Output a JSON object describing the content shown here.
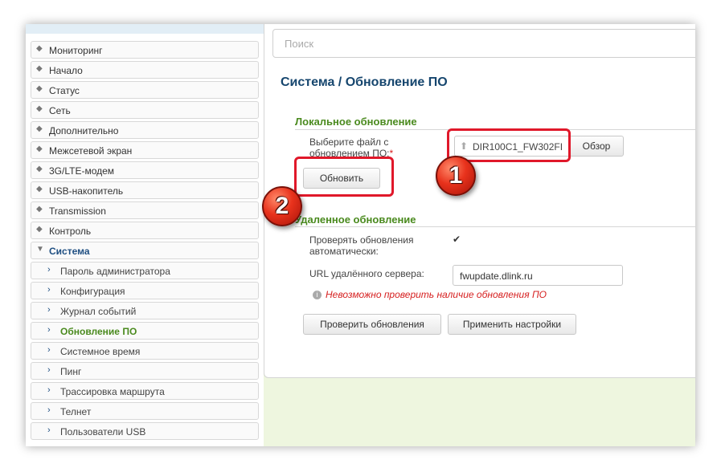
{
  "sidebar": {
    "items": [
      {
        "label": "Мониторинг"
      },
      {
        "label": "Начало"
      },
      {
        "label": "Статус"
      },
      {
        "label": "Сеть"
      },
      {
        "label": "Дополнительно"
      },
      {
        "label": "Межсетевой экран"
      },
      {
        "label": "3G/LTE-модем"
      },
      {
        "label": "USB-накопитель"
      },
      {
        "label": "Transmission"
      },
      {
        "label": "Контроль"
      },
      {
        "label": "Система"
      }
    ],
    "subitems": [
      {
        "label": "Пароль администратора"
      },
      {
        "label": "Конфигурация"
      },
      {
        "label": "Журнал событий"
      },
      {
        "label": "Обновление ПО"
      },
      {
        "label": "Системное время"
      },
      {
        "label": "Пинг"
      },
      {
        "label": "Трассировка маршрута"
      },
      {
        "label": "Телнет"
      },
      {
        "label": "Пользователи USB"
      }
    ]
  },
  "search": {
    "placeholder": "Поиск"
  },
  "page": {
    "breadcrumb_parent": "Система /",
    "title": "Обновление ПО"
  },
  "local": {
    "section_title": "Локальное обновление",
    "file_label": "Выберите файл с обновлением ПО:",
    "required_mark": "*",
    "file_name": "DIR100C1_FW302FI",
    "browse_label": "Обзор",
    "update_label": "Обновить"
  },
  "remote": {
    "section_title": "Удаленное обновление",
    "auto_check_label": "Проверять обновления автоматически:",
    "auto_check": true,
    "url_label": "URL удалённого сервера:",
    "url_value": "fwupdate.dlink.ru",
    "error_text": "Невозможно проверить наличие обновления ПО",
    "check_label": "Проверить обновления",
    "apply_label": "Применить настройки"
  },
  "annotations": {
    "badge1": "1",
    "badge2": "2"
  },
  "colors": {
    "accent_green": "#4a8a1e",
    "title_blue": "#16466e",
    "callout_red": "#e0182a"
  }
}
